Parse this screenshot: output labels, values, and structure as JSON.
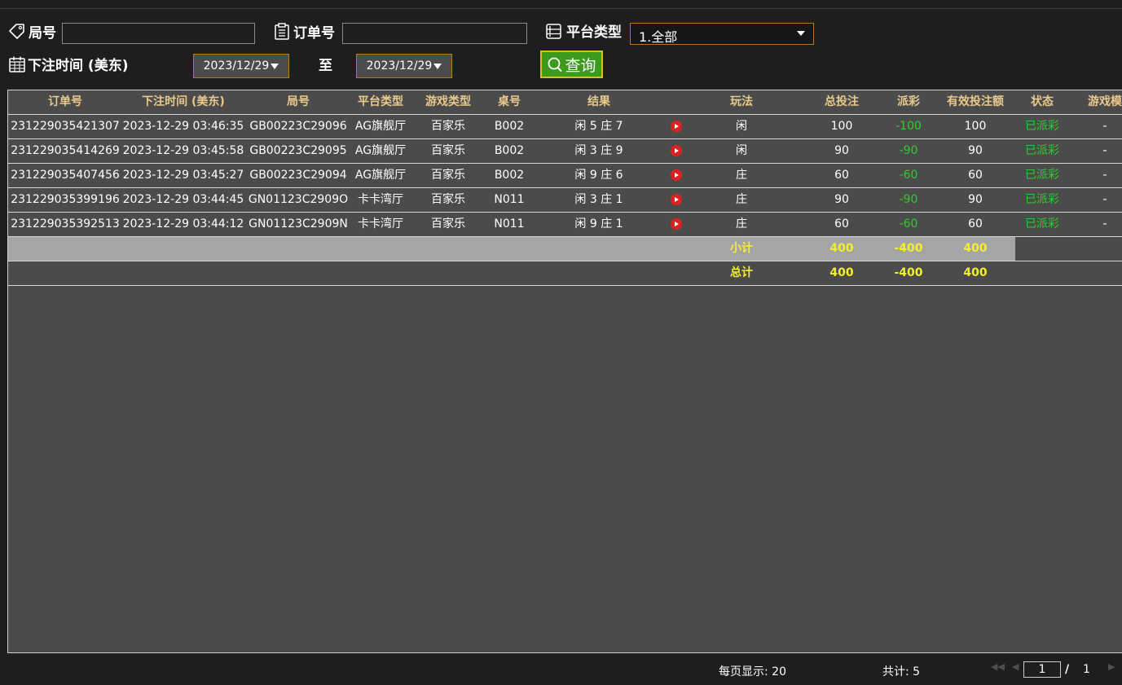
{
  "filters": {
    "round_label": "局号",
    "round_value": "",
    "order_label": "订单号",
    "order_value": "",
    "platform_label": "平台类型",
    "platform_selected": "1.全部",
    "time_label": "下注时间 (美东)",
    "date_from": "2023/12/29",
    "to_label": "至",
    "date_to": "2023/12/29",
    "query_label": "查询"
  },
  "table": {
    "headers": [
      "订单号",
      "下注时间 (美东)",
      "局号",
      "平台类型",
      "游戏类型",
      "桌号",
      "结果",
      "",
      "玩法",
      "总投注",
      "派彩",
      "有效投注额",
      "状态",
      "游戏模"
    ],
    "rows": [
      {
        "order": "231229035421307",
        "time": "2023-12-29 03:46:35",
        "round": "GB00223C29096",
        "platform": "AG旗舰厅",
        "game": "百家乐",
        "table": "B002",
        "result": "闲 5 庄 7",
        "play": "闲",
        "bet": "100",
        "payout": "-100",
        "valid": "100",
        "status": "已派彩",
        "mode": "-"
      },
      {
        "order": "231229035414269",
        "time": "2023-12-29 03:45:58",
        "round": "GB00223C29095",
        "platform": "AG旗舰厅",
        "game": "百家乐",
        "table": "B002",
        "result": "闲 3 庄 9",
        "play": "闲",
        "bet": "90",
        "payout": "-90",
        "valid": "90",
        "status": "已派彩",
        "mode": "-"
      },
      {
        "order": "231229035407456",
        "time": "2023-12-29 03:45:27",
        "round": "GB00223C29094",
        "platform": "AG旗舰厅",
        "game": "百家乐",
        "table": "B002",
        "result": "闲 9 庄 6",
        "play": "庄",
        "bet": "60",
        "payout": "-60",
        "valid": "60",
        "status": "已派彩",
        "mode": "-"
      },
      {
        "order": "231229035399196",
        "time": "2023-12-29 03:44:45",
        "round": "GN01123C2909O",
        "platform": "卡卡湾厅",
        "game": "百家乐",
        "table": "N011",
        "result": "闲 3 庄 1",
        "play": "庄",
        "bet": "90",
        "payout": "-90",
        "valid": "90",
        "status": "已派彩",
        "mode": "-"
      },
      {
        "order": "231229035392513",
        "time": "2023-12-29 03:44:12",
        "round": "GN01123C2909N",
        "platform": "卡卡湾厅",
        "game": "百家乐",
        "table": "N011",
        "result": "闲 9 庄 1",
        "play": "庄",
        "bet": "60",
        "payout": "-60",
        "valid": "60",
        "status": "已派彩",
        "mode": "-"
      }
    ],
    "subtotal": {
      "label": "小计",
      "bet": "400",
      "payout": "-400",
      "valid": "400"
    },
    "total": {
      "label": "总计",
      "bet": "400",
      "payout": "-400",
      "valid": "400"
    }
  },
  "pagination": {
    "per_page": "每页显示: 20",
    "total": "共计: 5",
    "current_page": "1",
    "separator": "/",
    "total_pages": "1"
  },
  "icons": {
    "round": "tag-icon",
    "order": "clipboard-icon",
    "platform": "list-icon",
    "time": "calendar-icon",
    "query": "search-icon",
    "replay": "play-icon"
  },
  "colors": {
    "accent_border": "#b5752f",
    "header_text": "#e9c98c",
    "payout_negative": "#2ecc2e",
    "status_paid": "#2ecc2e",
    "summary_text": "#f2f02a",
    "query_button": "#3c9a1c"
  }
}
